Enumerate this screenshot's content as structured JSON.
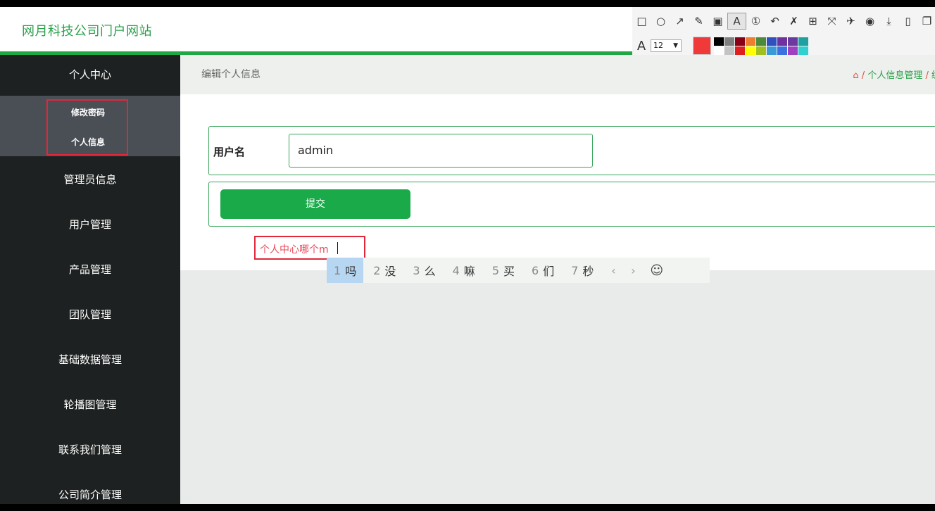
{
  "header": {
    "site_title": "网月科技公司门户网站"
  },
  "snip_toolbar": {
    "tools": [
      {
        "name": "rectangle-icon",
        "glyph": "□"
      },
      {
        "name": "ellipse-icon",
        "glyph": "○"
      },
      {
        "name": "arrow-icon",
        "glyph": "↗"
      },
      {
        "name": "pen-icon",
        "glyph": "✎"
      },
      {
        "name": "mosaic-icon",
        "glyph": "▣"
      },
      {
        "name": "text-tool-icon",
        "glyph": "A"
      },
      {
        "name": "number-marker-icon",
        "glyph": "①"
      },
      {
        "name": "undo-icon",
        "glyph": "↶"
      },
      {
        "name": "clear-icon",
        "glyph": "✗"
      },
      {
        "name": "ocr-icon",
        "glyph": "⊞"
      },
      {
        "name": "scroll-capture-icon",
        "glyph": "⤧"
      },
      {
        "name": "pin-icon",
        "glyph": "✈"
      },
      {
        "name": "record-icon",
        "glyph": "◉"
      },
      {
        "name": "download-icon",
        "glyph": "⤓"
      },
      {
        "name": "save-icon",
        "glyph": "▯"
      },
      {
        "name": "copy-icon",
        "glyph": "❐"
      }
    ],
    "font_size": "12",
    "current_color": "#f03a3a",
    "palette": [
      "#000000",
      "#7f7f7f",
      "#880015",
      "#ed7d31",
      "#4a8a3a",
      "#3050c0",
      "#7030a0",
      "#6a3aa0",
      "#20a0a0",
      "#ffffff",
      "#c3c3c3",
      "#e02020",
      "#ffff00",
      "#a0c020",
      "#3a9ad9",
      "#3a70e0",
      "#a040c0",
      "#30d0d0"
    ]
  },
  "sidebar": {
    "items": [
      {
        "label": "个人中心"
      },
      {
        "label": "管理员信息"
      },
      {
        "label": "用户管理"
      },
      {
        "label": "产品管理"
      },
      {
        "label": "团队管理"
      },
      {
        "label": "基础数据管理"
      },
      {
        "label": "轮播图管理"
      },
      {
        "label": "联系我们管理"
      },
      {
        "label": "公司简介管理"
      }
    ],
    "sub_items": [
      {
        "label": "修改密码"
      },
      {
        "label": "个人信息"
      }
    ]
  },
  "main": {
    "heading": "编辑个人信息",
    "breadcrumb": {
      "home_icon": "home-icon",
      "items": [
        "个人信息管理",
        "编"
      ]
    },
    "form": {
      "username_label": "用户名",
      "username_value": "admin",
      "submit_label": "提交"
    }
  },
  "annotation": {
    "text": "个人中心哪个m"
  },
  "ime": {
    "candidates": [
      {
        "num": "1",
        "text": "吗"
      },
      {
        "num": "2",
        "text": "没"
      },
      {
        "num": "3",
        "text": "么"
      },
      {
        "num": "4",
        "text": "嘛"
      },
      {
        "num": "5",
        "text": "买"
      },
      {
        "num": "6",
        "text": "们"
      },
      {
        "num": "7",
        "text": "秒"
      }
    ],
    "prev": "‹",
    "next": "›",
    "emoji": "☺"
  }
}
